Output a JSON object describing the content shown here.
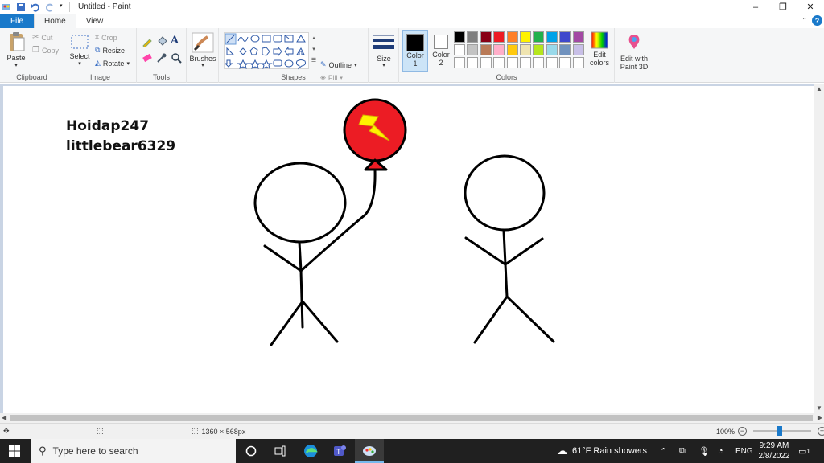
{
  "window": {
    "title": "Untitled - Paint",
    "controls": [
      "–",
      "❐",
      "✕"
    ]
  },
  "tabs": {
    "file": "File",
    "home": "Home",
    "view": "View"
  },
  "ribbon": {
    "clipboard": {
      "label": "Clipboard",
      "paste": "Paste",
      "cut": "Cut",
      "copy": "Copy"
    },
    "image": {
      "label": "Image",
      "select": "Select",
      "crop": "Crop",
      "resize": "Resize",
      "rotate": "Rotate"
    },
    "tools": {
      "label": "Tools"
    },
    "brushes": {
      "label": "Brushes"
    },
    "shapes": {
      "label": "Shapes",
      "outline": "Outline",
      "fill": "Fill"
    },
    "size": {
      "label": "Size"
    },
    "colors": {
      "label": "Colors",
      "color1": "Color",
      "color1_num": "1",
      "color2": "Color",
      "color2_num": "2",
      "edit_colors_1": "Edit",
      "edit_colors_2": "colors",
      "paint3d_1": "Edit with",
      "paint3d_2": "Paint 3D",
      "row1": [
        "#000000",
        "#7f7f7f",
        "#880015",
        "#ed1c24",
        "#ff7f27",
        "#fff200",
        "#22b14c",
        "#00a2e8",
        "#3f48cc",
        "#a349a4"
      ],
      "row2": [
        "#ffffff",
        "#c3c3c3",
        "#b97a57",
        "#ffaec9",
        "#ffc90e",
        "#efe4b0",
        "#b5e61d",
        "#99d9ea",
        "#7092be",
        "#c8bfe7"
      ],
      "row3": [
        "#ffffff",
        "#ffffff",
        "#ffffff",
        "#ffffff",
        "#ffffff",
        "#ffffff",
        "#ffffff",
        "#ffffff",
        "#ffffff",
        "#ffffff"
      ]
    }
  },
  "canvas": {
    "line1": "Hoidap247",
    "line2": "littlebear6329"
  },
  "status": {
    "dimensions": "1360 × 568px",
    "zoom": "100%"
  },
  "taskbar": {
    "search_placeholder": "Type here to search",
    "weather": "61°F  Rain showers",
    "lang": "ENG",
    "time": "9:29 AM",
    "date": "2/8/2022",
    "notifications": "1"
  }
}
